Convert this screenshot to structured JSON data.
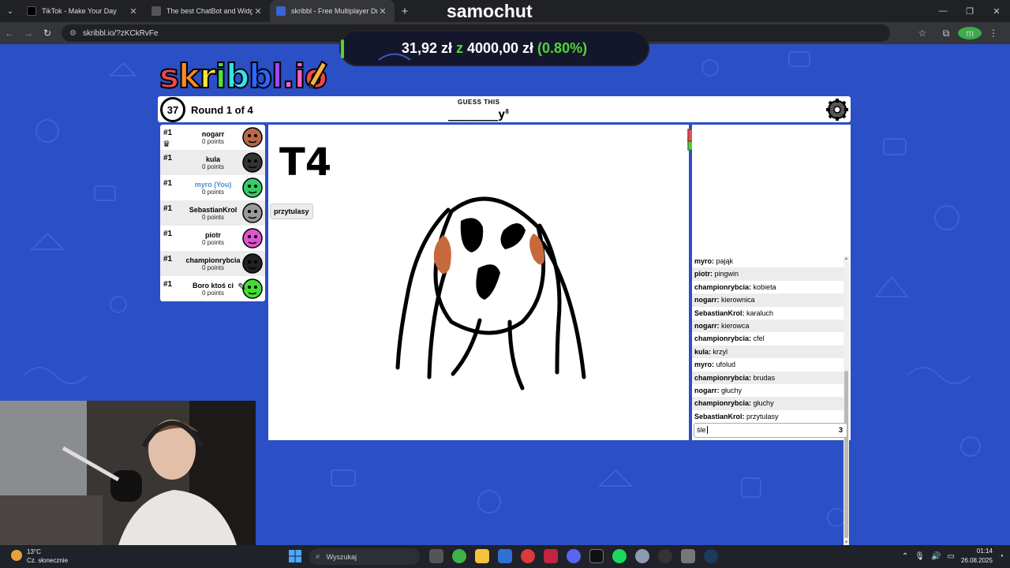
{
  "browser": {
    "tabs": [
      {
        "title": "TikTok - Make Your Day",
        "color": "#000000"
      },
      {
        "title": "The best ChatBot and Widgets",
        "color": "#444444"
      },
      {
        "title": "skribbl - Free Multiplayer Drawi",
        "color": "#3a63d8"
      }
    ],
    "url": "skribbl.io/?zKCkRvFe"
  },
  "stream": {
    "name": "samochut",
    "donation": {
      "current": "31,92 zł",
      "sep": "z",
      "goal": "4000,00 zł",
      "percent": "(0.80%)"
    }
  },
  "game": {
    "logo": "skribbl.io",
    "timer": "37",
    "round": "Round 1 of 4",
    "guess_label": "GUESS THIS",
    "word": "_______y",
    "word_length": "8",
    "canvas_text": "T4",
    "players": [
      {
        "rank": "#1",
        "name": "nogarr",
        "points": "0 points",
        "color": "#b7694a"
      },
      {
        "rank": "#1",
        "name": "kula",
        "points": "0 points",
        "color": "#333333"
      },
      {
        "rank": "#1",
        "name": "myro (You)",
        "points": "0 points",
        "color": "#33cc66"
      },
      {
        "rank": "#1",
        "name": "SebastianKrol",
        "points": "0 points",
        "color": "#999999"
      },
      {
        "rank": "#1",
        "name": "piotr",
        "points": "0 points",
        "color": "#dd55cc"
      },
      {
        "rank": "#1",
        "name": "championrybcia",
        "points": "0 points",
        "color": "#222222"
      },
      {
        "rank": "#1",
        "name": "Boro ktoś ci",
        "points": "0 points",
        "color": "#44dd33"
      }
    ],
    "bubble": "przytulasy",
    "chat": [
      {
        "user": "myro",
        "text": "pająk"
      },
      {
        "user": "piotr",
        "text": "pingwin"
      },
      {
        "user": "championrybcia",
        "text": "kobieta"
      },
      {
        "user": "nogarr",
        "text": "kierownica"
      },
      {
        "user": "SebastianKrol",
        "text": "karaluch"
      },
      {
        "user": "nogarr",
        "text": "kierowca"
      },
      {
        "user": "championrybcia",
        "text": "cfel"
      },
      {
        "user": "kula",
        "text": "krzyl"
      },
      {
        "user": "myro",
        "text": "ufolud"
      },
      {
        "user": "championrybcia",
        "text": "brudas"
      },
      {
        "user": "nogarr",
        "text": "głuchy"
      },
      {
        "user": "championrybcia",
        "text": "głuchy"
      },
      {
        "user": "SebastianKrol",
        "text": "przytulasy"
      }
    ],
    "chat_input": {
      "value": "śle",
      "count": "3"
    }
  },
  "taskbar": {
    "weather_temp": "13°C",
    "weather_desc": "Cz. słonecznie",
    "search": "Wyszukaj",
    "time": "01:14",
    "date": "26.08.2025"
  }
}
